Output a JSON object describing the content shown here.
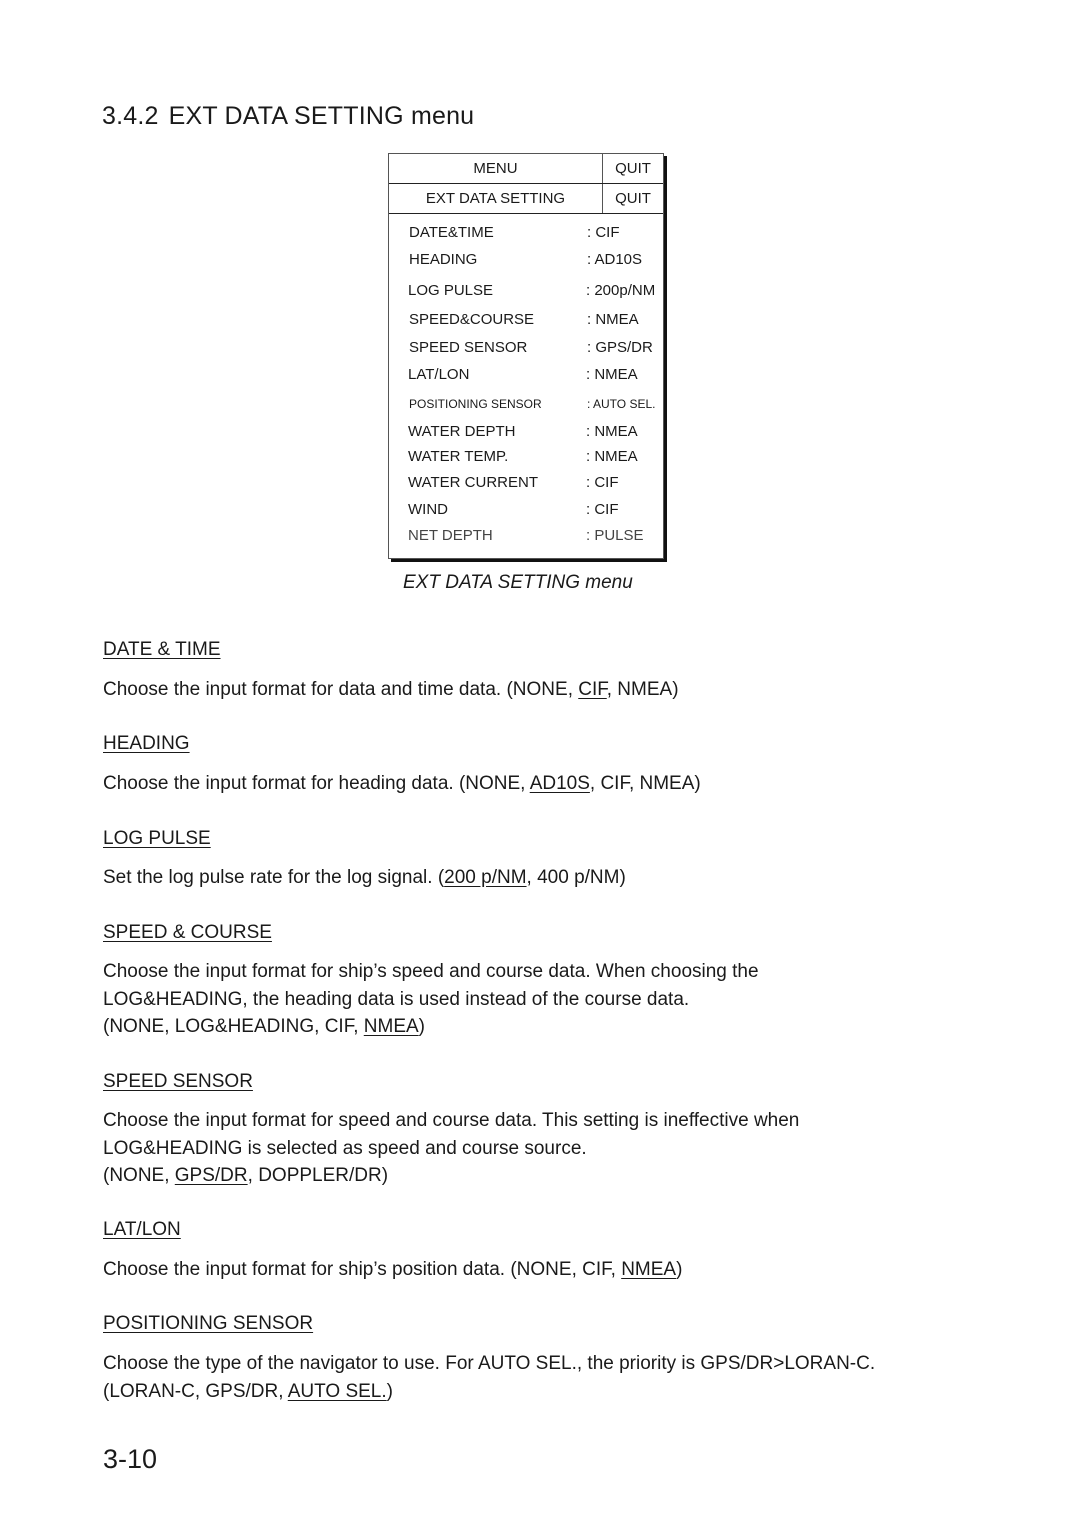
{
  "section": {
    "number": "3.4.2",
    "title": "EXT DATA SETTING menu"
  },
  "menu": {
    "header": {
      "title": "MENU",
      "quit": "QUIT"
    },
    "submenu": {
      "title": "EXT DATA SETTING",
      "quit": "QUIT"
    },
    "items": [
      {
        "label": "DATE&TIME",
        "value": ": CIF"
      },
      {
        "label": "HEADING",
        "value": ": AD10S"
      },
      {
        "label": "LOG PULSE",
        "value": ": 200p/NM"
      },
      {
        "label": "SPEED&COURSE",
        "value": ": NMEA"
      },
      {
        "label": "SPEED SENSOR",
        "value": ": GPS/DR"
      },
      {
        "label": "LAT/LON",
        "value": ": NMEA"
      },
      {
        "label": "POSITIONING SENSOR",
        "value": ": AUTO SEL."
      },
      {
        "label": "WATER DEPTH",
        "value": ": NMEA"
      },
      {
        "label": "WATER TEMP.",
        "value": ": NMEA"
      },
      {
        "label": "WATER CURRENT",
        "value": ": CIF"
      },
      {
        "label": "WIND",
        "value": ": CIF"
      },
      {
        "label": "NET DEPTH",
        "value": ": PULSE"
      }
    ],
    "caption": "EXT DATA SETTING menu"
  },
  "descriptions": [
    {
      "heading": "DATE & TIME",
      "lines": [
        "Choose the input format for data and time data. "
      ],
      "options_prefix": "(NONE, ",
      "options_default": "CIF",
      "options_suffix": ", NMEA)"
    },
    {
      "heading": "HEADING",
      "lines": [
        "Choose the input format for heading data. "
      ],
      "options_prefix": "(NONE, ",
      "options_default": "AD10S",
      "options_suffix": ", CIF, NMEA)"
    },
    {
      "heading": "LOG PULSE",
      "lines": [
        "Set the log pulse rate for the log signal. "
      ],
      "options_prefix": "(",
      "options_default": "200 p/NM",
      "options_suffix": ", 400 p/NM)"
    },
    {
      "heading": "SPEED & COURSE",
      "lines": [
        "Choose the input format for ship’s speed and course data. When choosing the",
        "LOG&HEADING, the heading data is used instead of the course data."
      ],
      "options_prefix": "(NONE, LOG&HEADING, CIF, ",
      "options_default": "NMEA",
      "options_suffix": ")"
    },
    {
      "heading": "SPEED SENSOR",
      "lines": [
        "Choose the input format for speed and course data. This setting is ineffective when",
        "LOG&HEADING is selected as speed and course source."
      ],
      "options_prefix": "(NONE, ",
      "options_default": "GPS/DR",
      "options_suffix": ", DOPPLER/DR)"
    },
    {
      "heading": "LAT/LON",
      "lines": [
        "Choose the input format for ship’s position data. "
      ],
      "options_prefix": "(NONE, CIF, ",
      "options_default": "NMEA",
      "options_suffix": ")"
    },
    {
      "heading": "POSITIONING SENSOR",
      "lines": [
        "Choose the type of the navigator to use. For AUTO SEL., the priority is GPS/DR>LORAN-C."
      ],
      "options_prefix": "(LORAN-C, GPS/DR, ",
      "options_default": "AUTO SEL.",
      "options_suffix": ")"
    }
  ],
  "page_number": "3-10"
}
